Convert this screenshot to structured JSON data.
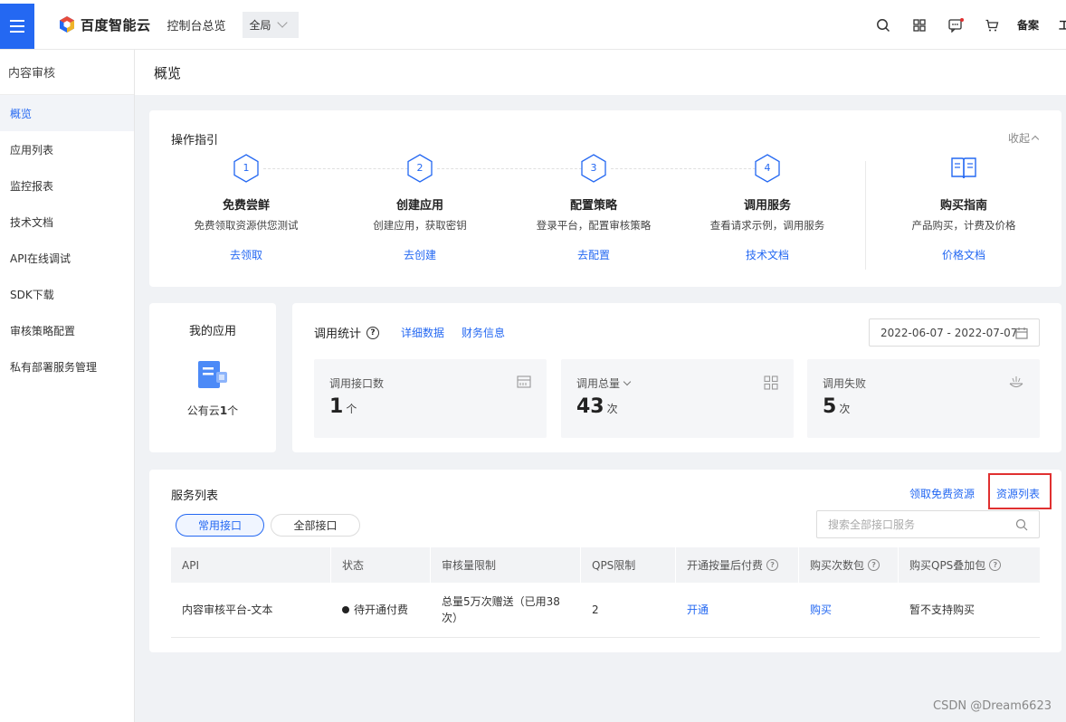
{
  "header": {
    "logo_text": "百度智能云",
    "console_title": "控制台总览",
    "region": "全局",
    "filing": "备案",
    "cut_text": "工"
  },
  "sidebar": {
    "title": "内容审核",
    "items": [
      {
        "label": "概览",
        "active": true
      },
      {
        "label": "应用列表"
      },
      {
        "label": "监控报表"
      },
      {
        "label": "技术文档"
      },
      {
        "label": "API在线调试"
      },
      {
        "label": "SDK下载"
      },
      {
        "label": "审核策略配置"
      },
      {
        "label": "私有部署服务管理"
      }
    ]
  },
  "page": {
    "title": "概览"
  },
  "guide": {
    "title": "操作指引",
    "collapse": "收起",
    "steps": [
      {
        "num": "1",
        "name": "免费尝鲜",
        "desc": "免费领取资源供您测试",
        "link": "去领取"
      },
      {
        "num": "2",
        "name": "创建应用",
        "desc": "创建应用，获取密钥",
        "link": "去创建"
      },
      {
        "num": "3",
        "name": "配置策略",
        "desc": "登录平台，配置审核策略",
        "link": "去配置"
      },
      {
        "num": "4",
        "name": "调用服务",
        "desc": "查看请求示例，调用服务",
        "link": "技术文档"
      }
    ],
    "buy": {
      "name": "购买指南",
      "desc": "产品购买，计费及价格",
      "link": "价格文档"
    }
  },
  "myapp": {
    "title": "我的应用",
    "prefix": "公有云",
    "count": "1",
    "suffix": "个"
  },
  "stats": {
    "title": "调用统计",
    "detail_link": "详细数据",
    "finance_link": "财务信息",
    "date_range": "2022-06-07 - 2022-07-07",
    "boxes": [
      {
        "label": "调用接口数",
        "value": "1",
        "unit": "个",
        "icon": "api-icon"
      },
      {
        "label": "调用总量",
        "value": "43",
        "unit": "次",
        "icon": "grid-icon"
      },
      {
        "label": "调用失败",
        "value": "5",
        "unit": "次",
        "icon": "fail-icon"
      }
    ]
  },
  "services": {
    "title": "服务列表",
    "free_link": "领取免费资源",
    "resource_link": "资源列表",
    "tabs": [
      "常用接口",
      "全部接口"
    ],
    "search_placeholder": "搜索全部接口服务",
    "columns": [
      "API",
      "状态",
      "审核量限制",
      "QPS限制",
      "开通按量后付费",
      "购买次数包",
      "购买QPS叠加包"
    ],
    "rows": [
      {
        "api": "内容审核平台-文本",
        "status": "待开通付费",
        "quota": "总量5万次赠送（已用38次）",
        "qps": "2",
        "pay": "开通",
        "buy": "购买",
        "qps_pack": "暂不支持购买"
      }
    ]
  },
  "watermark": "CSDN @Dream6623",
  "colors": {
    "accent": "#2468f2",
    "highlight": "#e03030"
  }
}
